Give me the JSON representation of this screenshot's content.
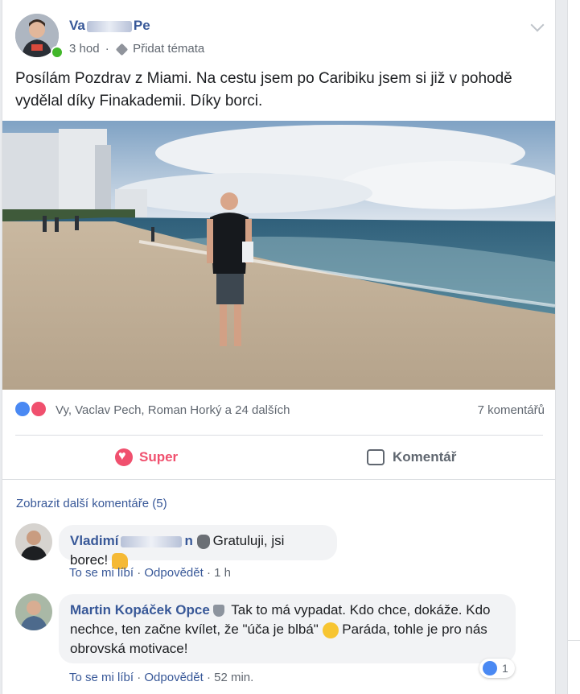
{
  "post": {
    "author_name_visible": "Va",
    "author_name_visible_end": "Pe",
    "time": "3 hod",
    "add_topics": "Přidat témata",
    "text": "Posílám Pozdrav z Miami. Na cestu jsem po Caribiku jsem si již v pohodě vydělal díky Finakademii. Díky borci."
  },
  "reactions": {
    "names": "Vy, Vaclav Pech, Roman Horký a 24 dalších",
    "comments_count": "7 komentářů"
  },
  "actions": {
    "super_label": "Super",
    "comment_label": "Komentář"
  },
  "comments": {
    "show_more": "Zobrazit další komentáře (5)",
    "items": [
      {
        "name_visible": "Vladimí",
        "name_visible_end": "n",
        "text": "Gratuluji, jsi borec!",
        "like_label": "To se mi líbí",
        "reply_label": "Odpovědět",
        "time": "1 h"
      },
      {
        "name": "Martin Kopáček Opce",
        "text_part1": "Tak to má vypadat. Kdo chce, dokáže. Kdo nechce, ten začne kvílet, že \"úča je blbá\"",
        "text_part2": "Paráda, tohle je pro nás obrovská motivace!",
        "like_label": "To se mi líbí",
        "reply_label": "Odpovědět",
        "time": "52 min.",
        "like_count": "1"
      }
    ]
  },
  "icons": {
    "like": "like-reaction-icon",
    "love": "love-reaction-icon",
    "heart": "heart-icon",
    "comment": "comment-bubble-icon",
    "tag": "tag-icon",
    "chevron": "chevron-down-icon",
    "shield": "shield-badge-icon"
  },
  "colors": {
    "link": "#385898",
    "super": "#f0506e",
    "like": "#4a89f3",
    "online": "#42b72a"
  }
}
